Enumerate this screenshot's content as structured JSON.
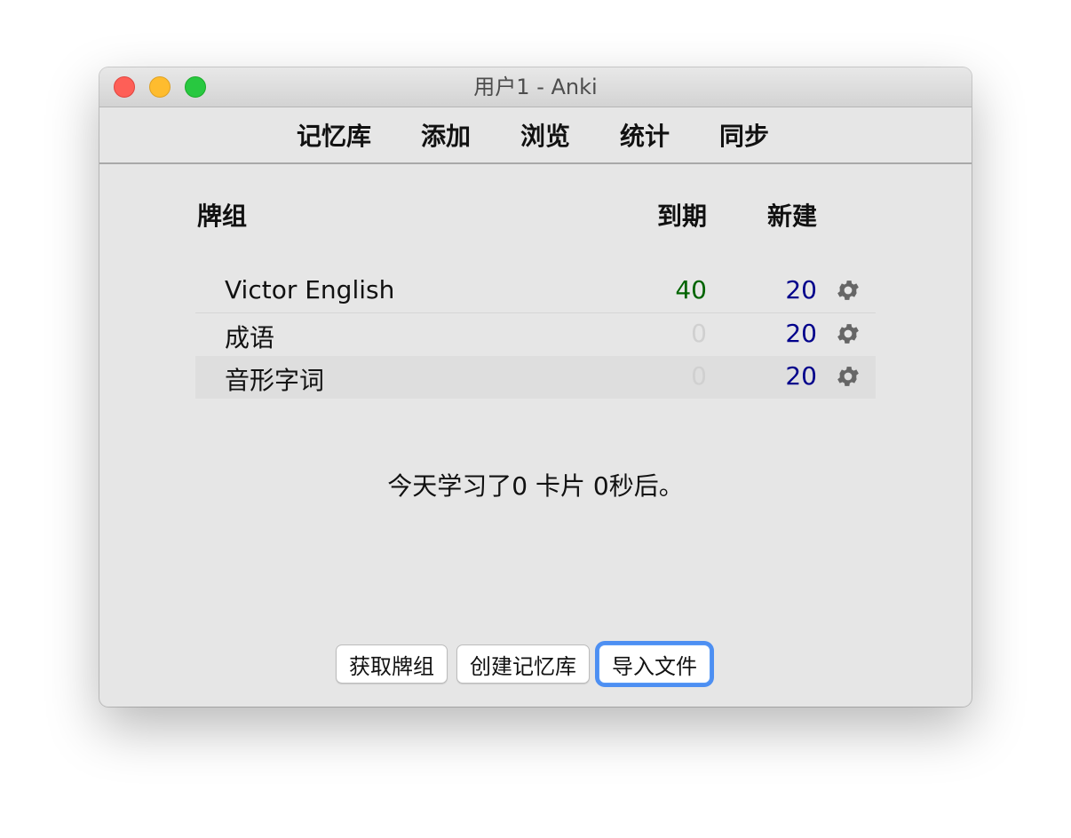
{
  "window": {
    "title": "用户1 - Anki"
  },
  "toolbar": {
    "items": [
      "记忆库",
      "添加",
      "浏览",
      "统计",
      "同步"
    ]
  },
  "deck_table": {
    "headers": {
      "deck": "牌组",
      "due": "到期",
      "new": "新建"
    },
    "rows": [
      {
        "name": "Victor English",
        "due": "40",
        "new": "20"
      },
      {
        "name": "成语",
        "due": "0",
        "new": "20"
      },
      {
        "name": "音形字词",
        "due": "0",
        "new": "20"
      }
    ],
    "gear_icon": "gear-icon"
  },
  "studied_text": "今天学习了0 卡片 0秒后。",
  "buttons": {
    "get_shared": "获取牌组",
    "create_deck": "创建记忆库",
    "import_file": "导入文件"
  },
  "colors": {
    "due_count": "#006400",
    "new_count": "#00008b",
    "zero_count": "#d0d0d0",
    "focus_ring": "#4d8ff2"
  }
}
